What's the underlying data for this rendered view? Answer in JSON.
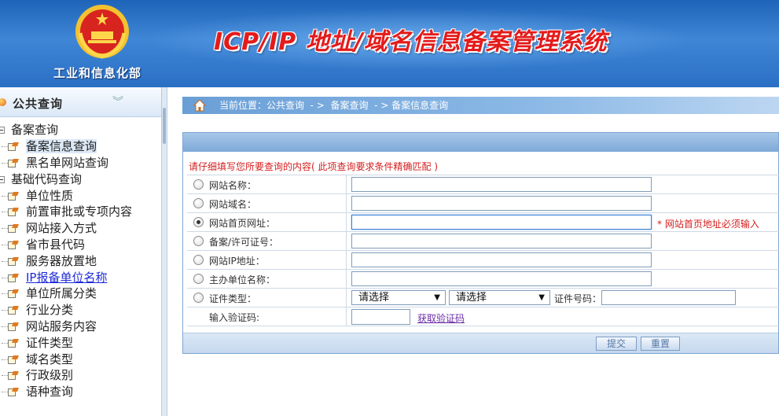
{
  "header": {
    "ministry": "工业和信息化部",
    "system_title": "ICP/IP 地址/域名信息备案管理系统",
    "emblem_icon": "national-emblem-icon"
  },
  "sidebar": {
    "section_title": "公共查询",
    "groups": [
      {
        "label": "备案查询",
        "items": [
          "备案信息查询",
          "黑名单网站查询"
        ]
      },
      {
        "label": "基础代码查询",
        "items": [
          "单位性质",
          "前置审批或专项内容",
          "网站接入方式",
          "省市县代码",
          "服务器放置地",
          "IP报备单位名称",
          "单位所属分类",
          "行业分类",
          "网站服务内容",
          "证件类型",
          "域名类型",
          "行政级别",
          "语种查询"
        ]
      }
    ]
  },
  "breadcrumb": {
    "text": "当前位置：公共查询  - >  备案查询  - > 备案信息查询"
  },
  "form": {
    "hint": "请仔细填写您所要查询的内容( 此项查询要求条件精确匹配 )",
    "fields": [
      "网站名称：",
      "网站域名：",
      "网站首页网址：",
      "备案/许可证号：",
      "网站IP地址：",
      "主办单位名称：",
      "证件类型："
    ],
    "selected_field": "网站首页网址：",
    "required_note": "* 网站首页地址必须输入",
    "select1": "请选择",
    "select2": "请选择",
    "id_number_label": "证件号码：",
    "captcha_label": "输入验证码:",
    "captcha_link": "获取验证码",
    "submit": "提交",
    "reset": "重置"
  },
  "colors": {
    "header_blue": "#2a6fc4",
    "title_red": "#e31b1b",
    "hint_red": "#d42020"
  }
}
